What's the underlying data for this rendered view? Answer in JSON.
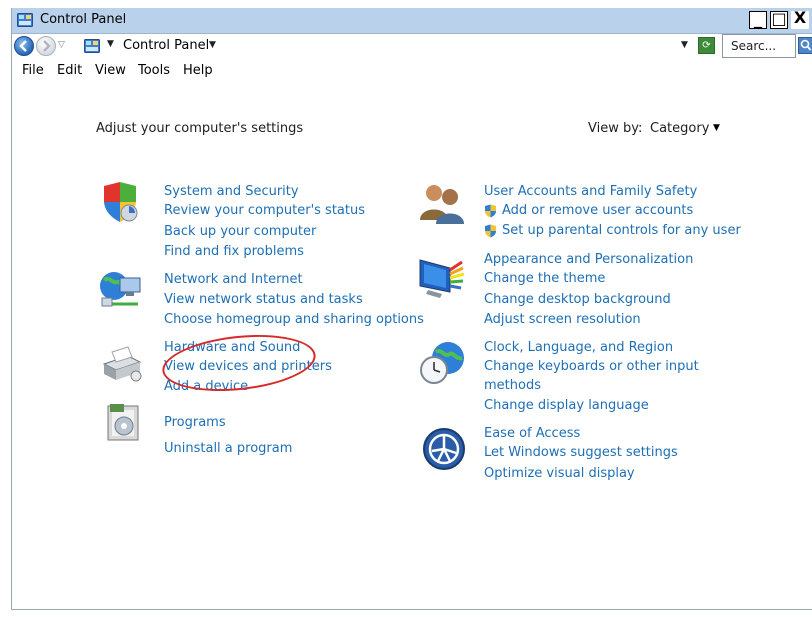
{
  "window": {
    "title": "Control Panel"
  },
  "titlebar_buttons": {
    "minimize": "_",
    "maximize": "□",
    "close": "X"
  },
  "nav": {
    "breadcrumb_label": "Control Panel",
    "search_placeholder": "Searc..."
  },
  "menu": [
    "File",
    "Edit",
    "View",
    "Tools",
    "Help"
  ],
  "main": {
    "heading": "Adjust your computer's settings",
    "view_by_label": "View by:",
    "view_by_value": "Category"
  },
  "categories": {
    "system_security": {
      "title": "System and Security",
      "links": [
        "Review your computer's status",
        "Back up your computer",
        "Find and fix problems"
      ]
    },
    "network": {
      "title": "Network and Internet",
      "links": [
        "View network status and tasks",
        "Choose homegroup and sharing options"
      ]
    },
    "hardware": {
      "title": "Hardware and Sound",
      "links": [
        "View devices and printers",
        "Add a device"
      ]
    },
    "programs": {
      "title": "Programs",
      "links": [
        "Uninstall a program"
      ]
    },
    "user_accounts": {
      "title": "User Accounts and Family Safety",
      "links": [
        "Add or remove user accounts",
        "Set up parental controls for any user"
      ]
    },
    "appearance": {
      "title": "Appearance and Personalization",
      "links": [
        "Change the theme",
        "Change desktop background",
        "Adjust screen resolution"
      ]
    },
    "clock": {
      "title": "Clock, Language, and Region",
      "links": [
        "Change keyboards or other input",
        "methods",
        "Change display language"
      ]
    },
    "ease": {
      "title": "Ease of Access",
      "links": [
        "Let Windows suggest settings",
        "Optimize visual display"
      ]
    }
  },
  "colors": {
    "link": "#1e6fb5",
    "titlebar": "#b9d1ea",
    "annotation": "#d62a2a"
  },
  "icons": {
    "title": "control-panel-icon",
    "back": "back-arrow-icon",
    "forward": "forward-arrow-icon",
    "refresh": "refresh-icon",
    "search": "search-icon",
    "system_security": "shield-icon",
    "network": "globe-network-icon",
    "hardware": "printer-icon",
    "programs": "programs-icon",
    "user_accounts": "users-icon",
    "appearance": "monitor-colors-icon",
    "clock": "clock-globe-icon",
    "ease": "ease-of-access-icon",
    "uac": "uac-shield-icon"
  }
}
